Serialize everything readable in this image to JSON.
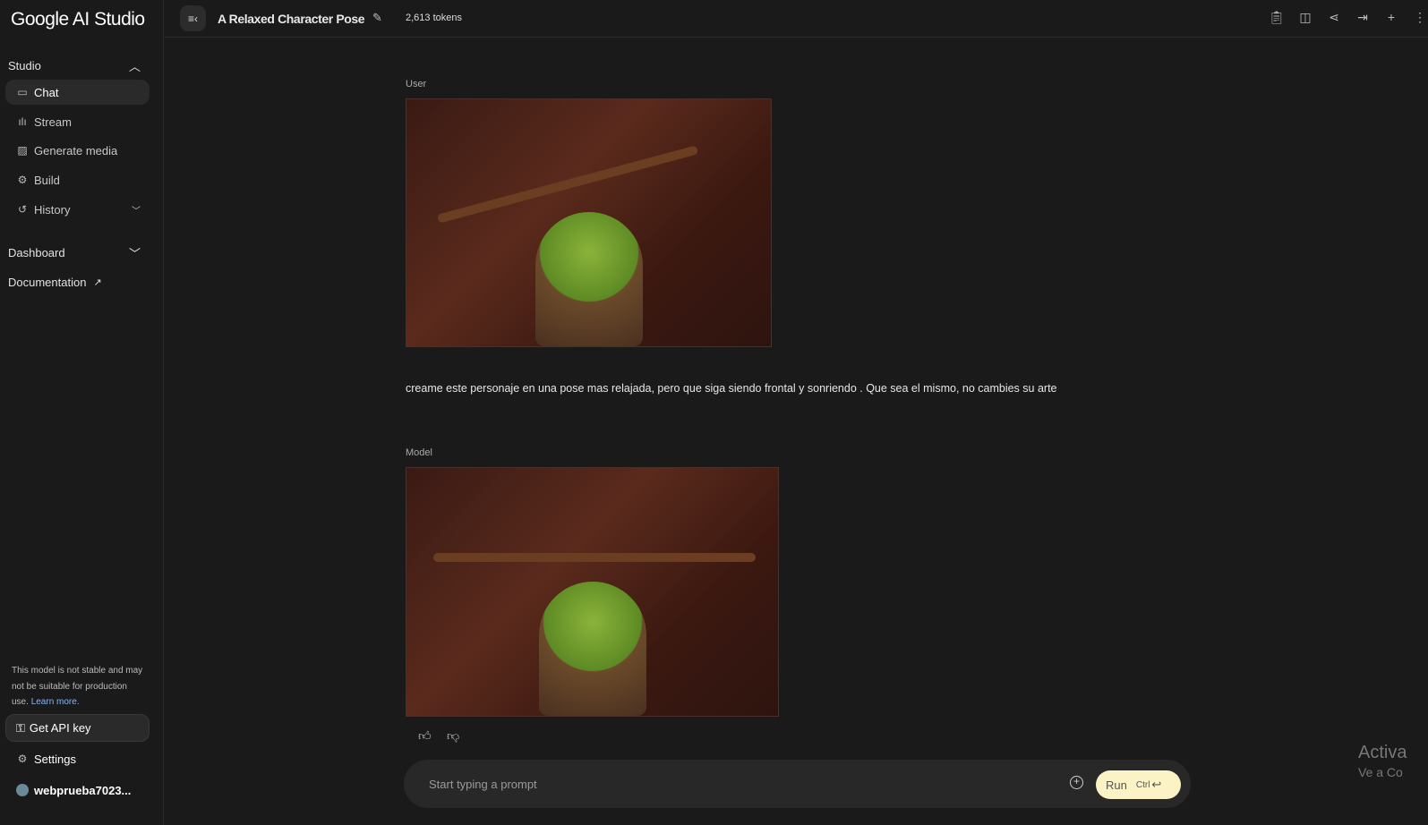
{
  "sidebar": {
    "logo": "Google AI Studio",
    "studio": "Studio",
    "items": [
      {
        "label": "Chat"
      },
      {
        "label": "Stream"
      },
      {
        "label": "Generate media"
      },
      {
        "label": "Build"
      },
      {
        "label": "History"
      }
    ],
    "dashboard": "Dashboard",
    "documentation": "Documentation",
    "note": "This model is not stable and may not be suitable for production use.",
    "learn_more": "Learn more.",
    "api_key": "Get API key",
    "settings": "Settings",
    "user": "webprueba7023..."
  },
  "header": {
    "title": "A Relaxed Character Pose",
    "tokens": "2,613 tokens"
  },
  "chat": {
    "user_role": "User",
    "user_message": "creame este personaje en una pose mas relajada, pero que siga siendo frontal y sonriendo . Que sea el mismo, no cambies su arte",
    "model_role": "Model"
  },
  "prompt": {
    "placeholder": "Start typing a prompt",
    "run": "Run",
    "shortcut": "Ctrl"
  },
  "watermark": {
    "line1": "Activa",
    "line2": "Ve a Co"
  }
}
